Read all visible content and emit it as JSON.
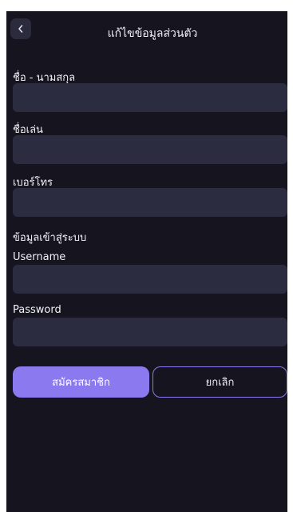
{
  "header": {
    "title": "แก้ไขข้อมูลส่วนตัว",
    "back_icon": "chevron-left-icon"
  },
  "form": {
    "fullname": {
      "label": "ชื่อ - นามสกุล",
      "value": ""
    },
    "nickname": {
      "label": "ชื่อเล่น",
      "value": ""
    },
    "phone": {
      "label": "เบอร์โทร",
      "value": ""
    },
    "login_section_title": "ข้อมูลเข้าสู่ระบบ",
    "username": {
      "label": "Username",
      "value": ""
    },
    "password": {
      "label": "Password",
      "value": ""
    }
  },
  "actions": {
    "submit_label": "สมัครสมาชิก",
    "cancel_label": "ยกเลิก"
  },
  "colors": {
    "background": "#16151f",
    "field": "#2b2c3f",
    "accent": "#8b79ef"
  }
}
